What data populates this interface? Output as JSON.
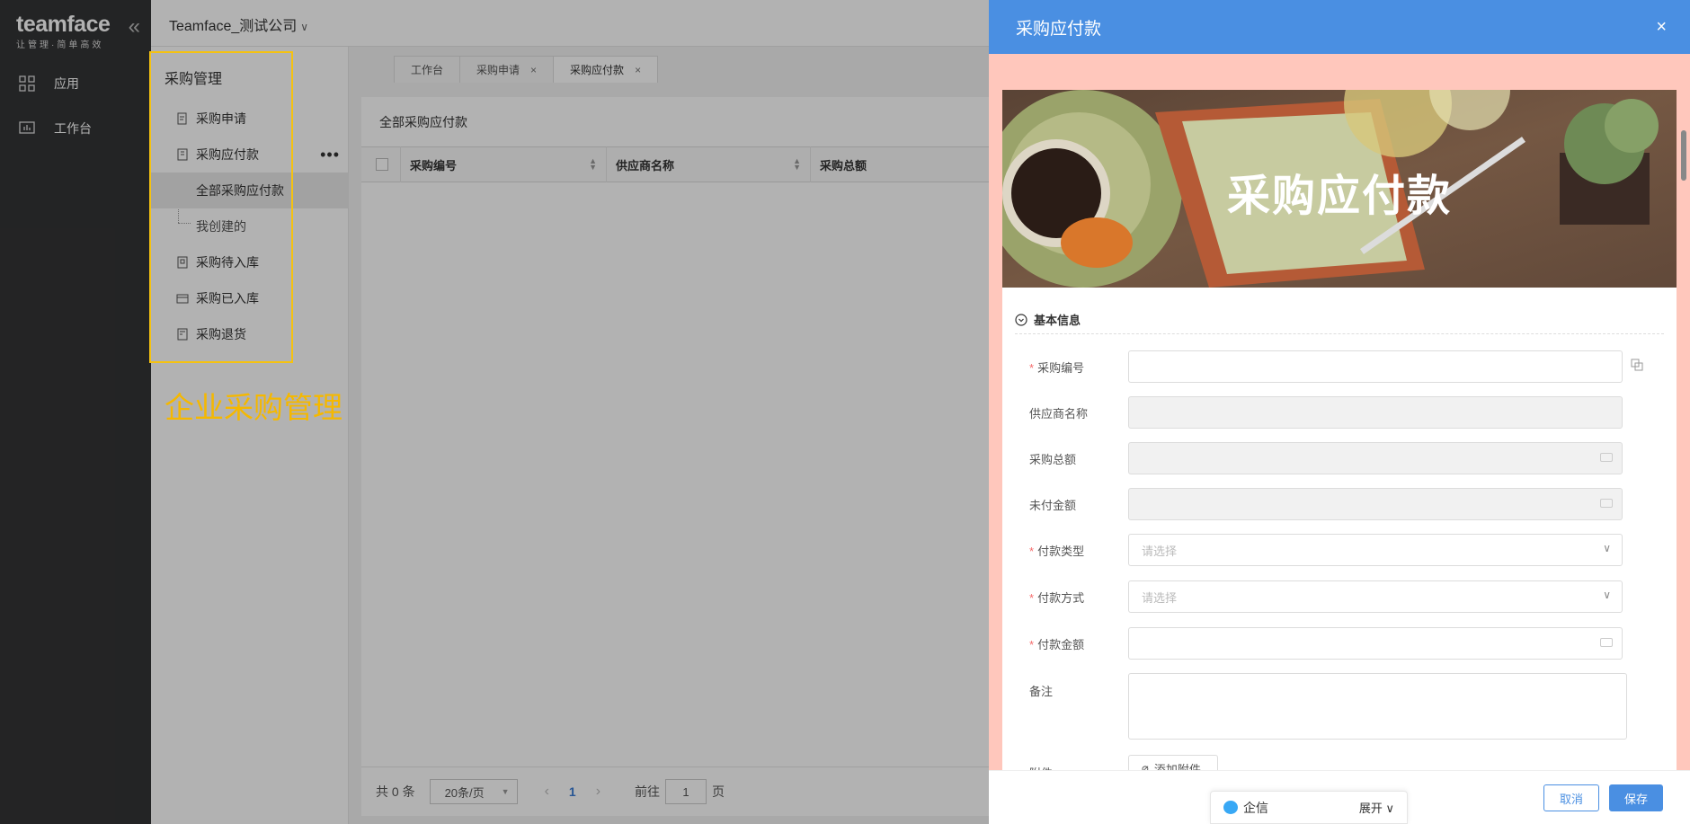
{
  "brand": {
    "logo": "teamface",
    "tagline": "让管理·简单高效",
    "collapse": "«"
  },
  "left_nav": [
    {
      "label": "应用",
      "icon": "apps-icon"
    },
    {
      "label": "工作台",
      "icon": "dashboard-icon"
    }
  ],
  "topbar": {
    "company": "Teamface_测试公司",
    "caret": "∨"
  },
  "sub_menu": {
    "title": "采购管理",
    "items": [
      {
        "label": "采购申请"
      },
      {
        "label": "采购应付款",
        "more": "•••"
      },
      {
        "label": "全部采购应付款"
      },
      {
        "label": "我创建的"
      },
      {
        "label": "采购待入库"
      },
      {
        "label": "采购已入库"
      },
      {
        "label": "采购退货"
      }
    ]
  },
  "annotation": {
    "caption": "企业采购管理",
    "box_color": "#f5c211"
  },
  "tabs": [
    {
      "label": "工作台",
      "close": ""
    },
    {
      "label": "采购申请",
      "close": "×"
    },
    {
      "label": "采购应付款",
      "close": "×"
    }
  ],
  "list": {
    "title": "全部采购应付款",
    "columns": [
      "采购编号",
      "供应商名称",
      "采购总额"
    ],
    "pager": {
      "total": "共 0 条",
      "page_size": "20条/页",
      "prev": "‹",
      "current": "1",
      "next": "›",
      "goto_label": "前往",
      "goto_value": "1",
      "page_suffix": "页"
    }
  },
  "drawer": {
    "title": "采购应付款",
    "close": "×",
    "banner_title": "采购应付款",
    "section": "基本信息",
    "fields": [
      {
        "label": "采购编号",
        "required": "*",
        "placeholder": ""
      },
      {
        "label": "供应商名称",
        "required": "",
        "placeholder": ""
      },
      {
        "label": "采购总额",
        "required": "",
        "placeholder": ""
      },
      {
        "label": "未付金额",
        "required": "",
        "placeholder": ""
      },
      {
        "label": "付款类型",
        "required": "*",
        "placeholder": "请选择"
      },
      {
        "label": "付款方式",
        "required": "*",
        "placeholder": "请选择"
      },
      {
        "label": "付款金额",
        "required": "*",
        "placeholder": ""
      },
      {
        "label": "备注",
        "required": "",
        "placeholder": ""
      },
      {
        "label": "附件",
        "required": "",
        "placeholder": ""
      }
    ],
    "attach_button": "添加附件",
    "cancel": "取消",
    "save": "保存",
    "accent": "#4a8fe2",
    "body_bg": "#ffc7bc"
  },
  "im": {
    "label": "企信",
    "expand": "展开"
  }
}
